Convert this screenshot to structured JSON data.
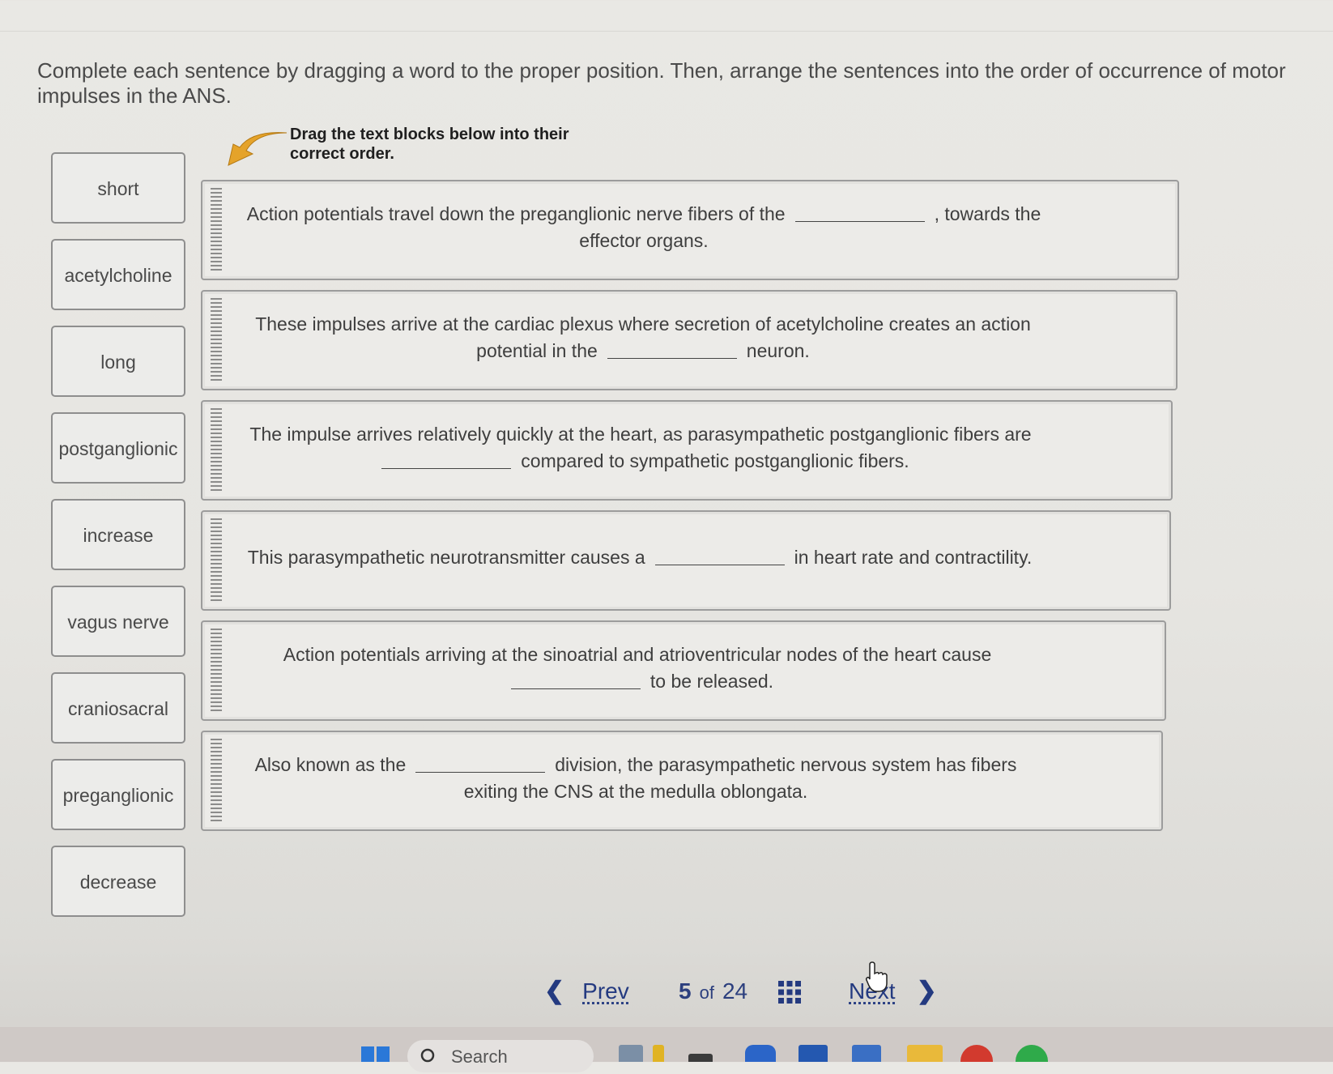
{
  "instructions": "Complete each sentence by dragging a word to the proper position. Then, arrange the sentences into the order of occurrence of motor impulses in the ANS.",
  "drag_hint": "Drag the text blocks below into their correct order.",
  "word_bank": [
    "short",
    "acetylcholine",
    "long",
    "postganglionic",
    "increase",
    "vagus nerve",
    "craniosacral",
    "preganglionic",
    "decrease"
  ],
  "sentences": [
    {
      "before": "Action potentials travel down the preganglionic nerve fibers of the",
      "after": ", towards the effector organs."
    },
    {
      "before": "These impulses arrive at the cardiac plexus where secretion of acetylcholine creates an action potential in the",
      "after": "neuron."
    },
    {
      "before": "The impulse arrives relatively quickly at the heart, as parasympathetic postganglionic fibers are",
      "after": "compared to sympathetic postganglionic fibers."
    },
    {
      "before": "This parasympathetic neurotransmitter causes a",
      "after": "in heart rate and contractility."
    },
    {
      "before": "Action potentials arriving at the sinoatrial and atrioventricular nodes of the heart cause",
      "after": "to be released."
    },
    {
      "before": "Also known as the",
      "after": "division, the parasympathetic nervous system has fibers exiting the CNS at the medulla oblongata."
    }
  ],
  "nav": {
    "prev": "Prev",
    "current": "5",
    "of": "of",
    "total": "24",
    "next": "Next"
  },
  "taskbar": {
    "search_placeholder": "Search"
  },
  "icons": {
    "hint": "arrow-icon",
    "grip": "drag-handle-icon",
    "grid": "grid-icon",
    "cursor": "hand-cursor-icon"
  },
  "colors": {
    "nav": "#243a80",
    "hint_arrow": "#e5a32a"
  }
}
